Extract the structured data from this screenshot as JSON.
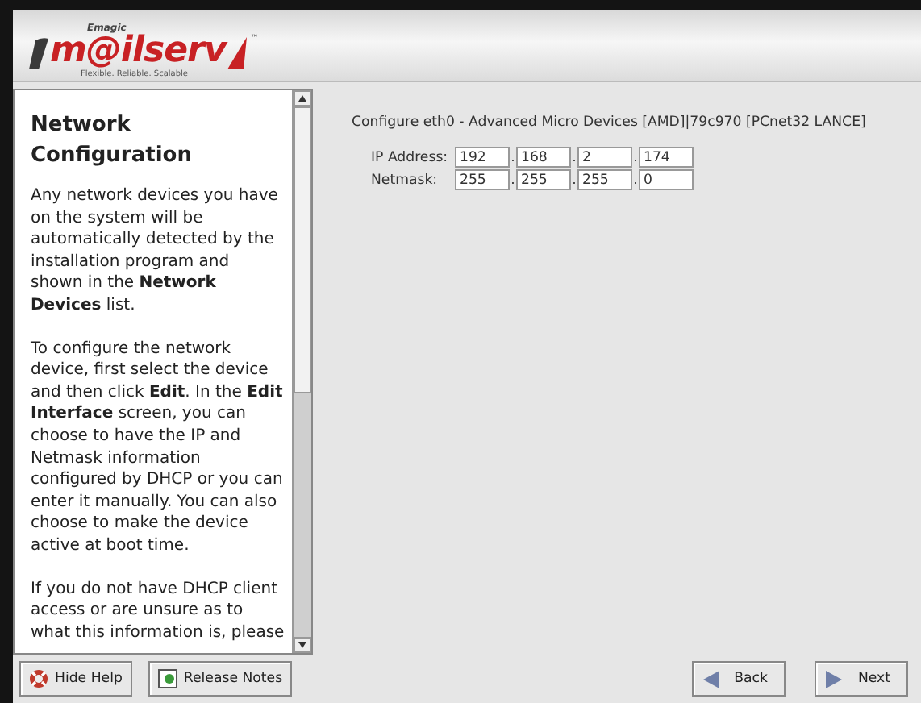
{
  "logo": {
    "tagline_top": "Emagic",
    "name": "m@ilserv",
    "trademark": "™",
    "slogan": "Flexible. Reliable. Scalable"
  },
  "help": {
    "title": "Network Configuration",
    "paragraphs": [
      "Any network devices you have on the system will be automatically detected by the installation program and shown in the **Network Devices** list.",
      "To configure the network device, first select the device and then click **Edit**. In the **Edit Interface** screen, you can choose to have the IP and Netmask information configured by DHCP or you can enter it manually. You can also choose to make the device active at boot time.",
      "If you do not have DHCP client access or are unsure as to what this information is, please"
    ]
  },
  "config": {
    "heading": "Configure eth0 - Advanced Micro Devices [AMD]|79c970 [PCnet32 LANCE]",
    "rows": [
      {
        "label": "IP Address:",
        "octets": [
          "192",
          "168",
          "2",
          "174"
        ]
      },
      {
        "label": "Netmask:",
        "octets": [
          "255",
          "255",
          "255",
          "0"
        ]
      }
    ],
    "separator": "."
  },
  "buttons": [
    {
      "kind": "help",
      "label": "Hide Help"
    },
    {
      "kind": "notes",
      "label": "Release Notes"
    },
    {
      "kind": "back",
      "label": "Back"
    },
    {
      "kind": "next",
      "label": "Next"
    }
  ]
}
